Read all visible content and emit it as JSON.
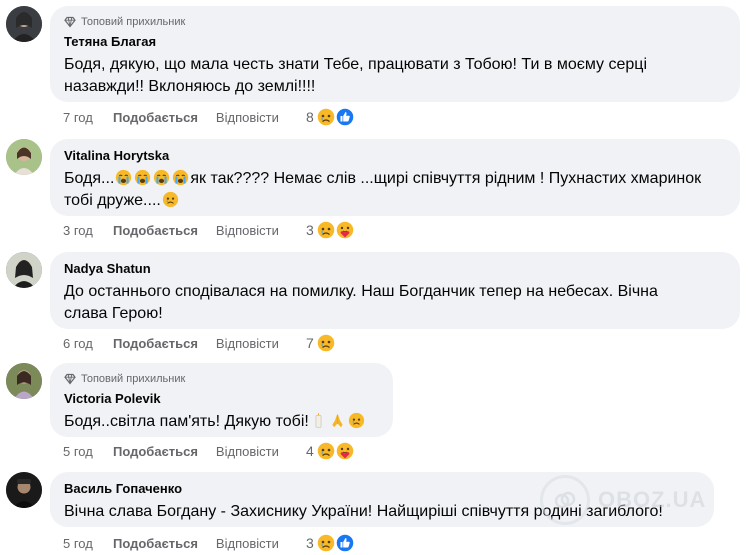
{
  "comments": [
    {
      "badge": "Топовий прихильник",
      "author": "Тетяна Благая",
      "lines": [
        "Бодя, дякую, що мала честь знати Тебе, працювати з Тобою! Ти в моєму серці",
        "назавжди!! Вклоняюсь до землі!!!!"
      ],
      "time": "7 год",
      "like": "Подобається",
      "reply": "Відповісти",
      "reaction_count": "8",
      "reactions": [
        "sad-icon",
        "like-icon"
      ]
    },
    {
      "author": "Vitalina Horytska",
      "line1_start": "Бодя...",
      "line1_end": "як так???? Немає слів ...щирі співчуття рідним ! Пухнастих хмаринок",
      "line2": "тобі друже....",
      "time": "3 год",
      "like": "Подобається",
      "reply": "Відповісти",
      "reaction_count": "3",
      "reactions": [
        "sad-icon",
        "care-icon"
      ]
    },
    {
      "author": "Nadya Shatun",
      "lines": [
        "До останнього сподівалася на помилку. Наш Богданчик тепер на небесах. Вічна",
        "слава Герою!"
      ],
      "time": "6 год",
      "like": "Подобається",
      "reply": "Відповісти",
      "reaction_count": "7",
      "reactions": [
        "sad-icon"
      ]
    },
    {
      "badge": "Топовий прихильник",
      "author": "Victoria Polevik",
      "line1": "Бодя..світла пам'ять! Дякую тобі!",
      "time": "5 год",
      "like": "Подобається",
      "reply": "Відповісти",
      "reaction_count": "4",
      "reactions": [
        "sad-icon",
        "care-icon"
      ]
    },
    {
      "author": "Василь Гопаченко",
      "lines": [
        "Вічна слава Богдану - Захиснику України! Найщиріші співчуття родині загиблого!"
      ],
      "time": "5 год",
      "like": "Подобається",
      "reply": "Відповісти",
      "reaction_count": "3",
      "reactions": [
        "sad-icon",
        "like-icon"
      ]
    }
  ],
  "watermark": "OBOZ.UA",
  "colors": {
    "bubble": "#f0f2f5",
    "meta": "#65676b",
    "like_blue": "#1877f2",
    "sad_yellow": "#f7b928",
    "care_red": "#e4284a"
  }
}
